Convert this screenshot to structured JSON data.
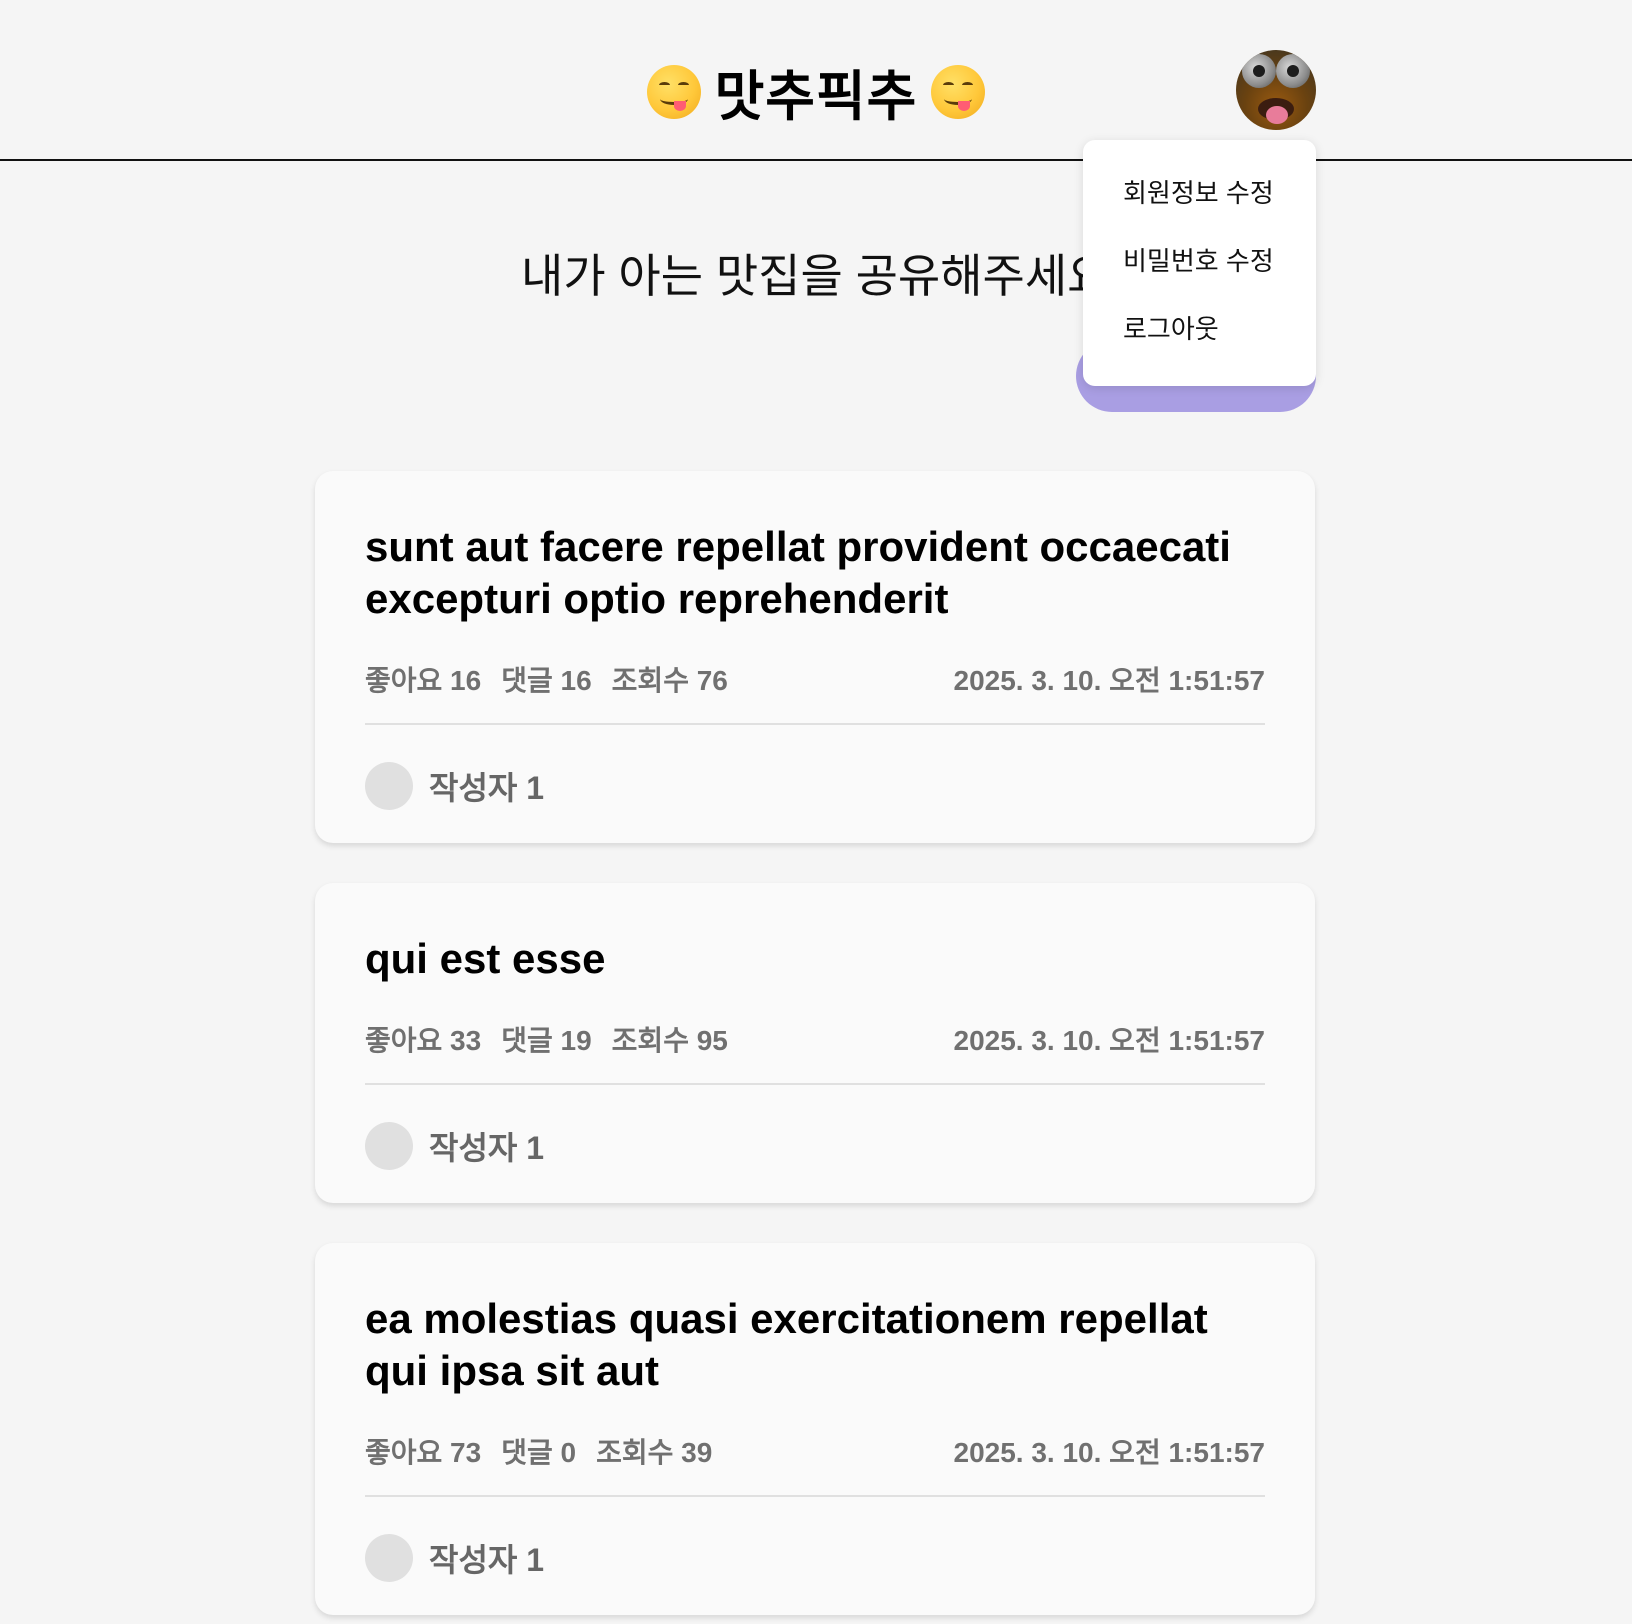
{
  "header": {
    "logo_text": "맛추픽추",
    "logo_left_icon": "yum-face-emoji",
    "logo_right_icon": "yum-face-emoji",
    "avatar": "user-avatar-image"
  },
  "dropdown": {
    "items": [
      {
        "label": "회원정보 수정"
      },
      {
        "label": "비밀번호 수정"
      },
      {
        "label": "로그아웃"
      }
    ]
  },
  "main": {
    "subtitle": "내가 아는 맛집을 공유해주세요",
    "write_button_label": "",
    "accent_color": "#a99ee3"
  },
  "posts": [
    {
      "title": "sunt aut facere repellat provident occaecati excepturi optio reprehenderit",
      "likes": "좋아요 16",
      "comments": "댓글 16",
      "views": "조회수 76",
      "date": "2025. 3. 10. 오전 1:51:57",
      "author": "작성자 1"
    },
    {
      "title": "qui est esse",
      "likes": "좋아요 33",
      "comments": "댓글 19",
      "views": "조회수 95",
      "date": "2025. 3. 10. 오전 1:51:57",
      "author": "작성자 1"
    },
    {
      "title": "ea molestias quasi exercitationem repellat qui ipsa sit aut",
      "likes": "좋아요 73",
      "comments": "댓글 0",
      "views": "조회수 39",
      "date": "2025. 3. 10. 오전 1:51:57",
      "author": "작성자 1"
    }
  ]
}
